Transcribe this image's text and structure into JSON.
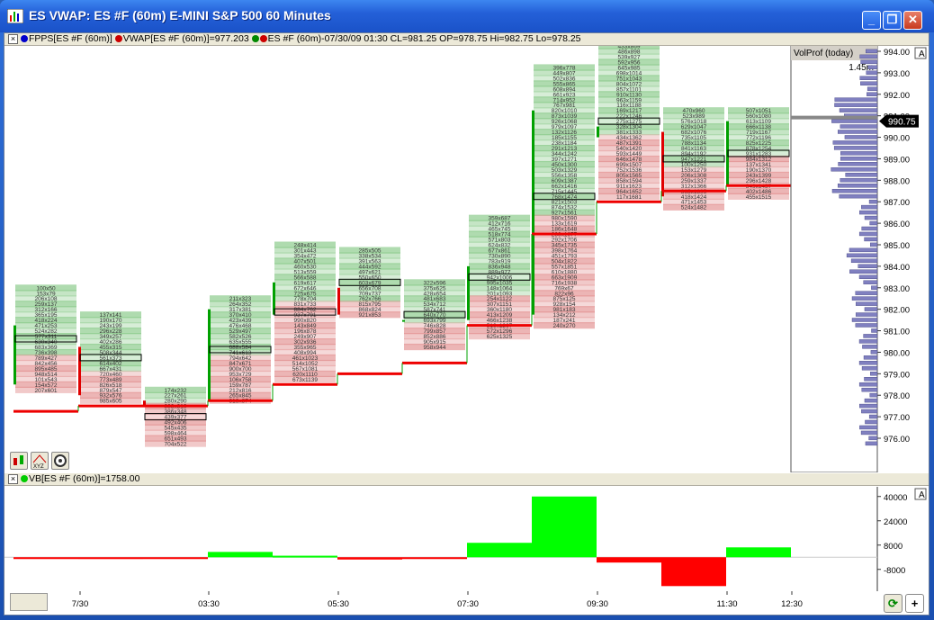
{
  "window": {
    "title": "ES VWAP: ES #F (60m) E-MINI S&P 500 60 Minutes",
    "minimize_label": "_",
    "restore_label": "❐",
    "close_label": "✕"
  },
  "top_panel": {
    "legend_fpps": "FPPS[ES #F (60m)]",
    "legend_vwap": "VWAP[ES #F (60m)]=977.203",
    "legend_price": "ES #F (60m)-07/30/09 01:30 CL=981.25 OP=978.75 Hi=982.75 Lo=978.25",
    "volprof_label": "VolProf (today)",
    "volprof_tick": "1.45m",
    "current_price": "990.75",
    "price_axis": [
      "994.00",
      "993.00",
      "992.00",
      "991.00",
      "990.00",
      "989.00",
      "988.00",
      "987.00",
      "986.00",
      "985.00",
      "984.00",
      "983.00",
      "982.00",
      "981.00",
      "980.00",
      "979.00",
      "978.00",
      "977.00",
      "976.00"
    ],
    "scale_marker": "A"
  },
  "bottom_panel": {
    "legend_vb": "VB[ES #F (60m)]=1758.00",
    "vol_axis": [
      "40000",
      "24000",
      "8000",
      "-8000"
    ],
    "scale_marker": "A"
  },
  "time_axis": [
    "7/30",
    "03:30",
    "05:30",
    "07:30",
    "09:30",
    "11:30",
    "12:30"
  ],
  "bottom_buttons": {
    "refresh": "⟳",
    "add": "+"
  },
  "colors": {
    "up": "#00a000",
    "down": "#e00000",
    "vwap": "#ee0000",
    "volbar_up": "#00ff00",
    "volbar_down": "#ff0000",
    "profile": "#8080c0"
  },
  "chart_data": {
    "type": "bar",
    "ohlc_hourly": [
      {
        "o": 978.5,
        "h": 983.0,
        "l": 978.25,
        "c": 981.25
      },
      {
        "o": 980.25,
        "h": 981.75,
        "l": 977.75,
        "c": 978.0
      },
      {
        "o": 977.75,
        "h": 978.25,
        "l": 975.75,
        "c": 977.5
      },
      {
        "o": 977.75,
        "h": 982.5,
        "l": 977.75,
        "c": 982.0
      },
      {
        "o": 981.75,
        "h": 985.0,
        "l": 978.75,
        "c": 983.25
      },
      {
        "o": 983.0,
        "h": 984.75,
        "l": 981.75,
        "c": 981.75
      },
      {
        "o": 981.5,
        "h": 983.25,
        "l": 980.25,
        "c": 981.5
      },
      {
        "o": 981.5,
        "h": 986.25,
        "l": 980.75,
        "c": 984.0
      },
      {
        "o": 981.75,
        "h": 993.25,
        "l": 981.25,
        "c": 991.25
      },
      {
        "o": 990.0,
        "h": 994.25,
        "l": 987.25,
        "c": 990.5
      },
      {
        "o": 990.25,
        "h": 991.25,
        "l": 986.75,
        "c": 987.25
      },
      {
        "o": 987.75,
        "h": 991.25,
        "l": 987.25,
        "c": 990.75
      }
    ],
    "vwap": [
      977.25,
      977.5,
      977.5,
      977.75,
      978.5,
      979.0,
      979.5,
      981.25,
      985.5,
      987.0,
      987.5,
      987.75
    ],
    "volume_delta": {
      "series": [
        {
          "name": "VB",
          "values": [
            -500,
            -1200,
            -800,
            3500,
            1000,
            -1500,
            -500,
            9500,
            40000,
            -3500,
            -19000,
            6500
          ]
        }
      ],
      "ylim": [
        -20000,
        44000
      ]
    }
  }
}
